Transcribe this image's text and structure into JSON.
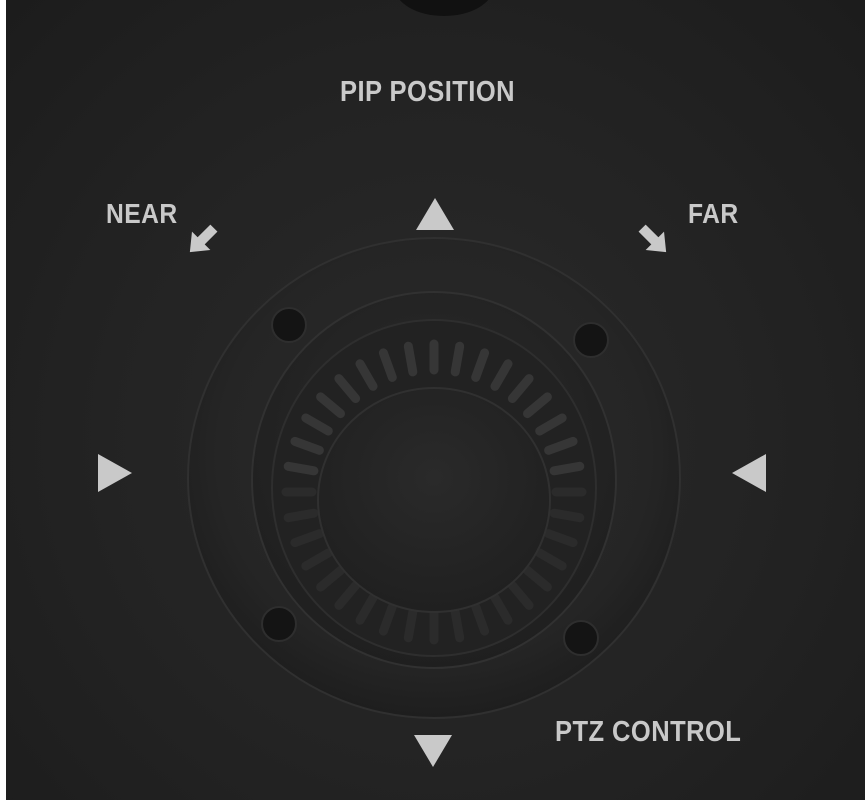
{
  "panel": {
    "title_label": "PIP POSITION",
    "near_label": "NEAR",
    "far_label": "FAR",
    "control_label": "PTZ CONTROL",
    "colors": {
      "background": "#232323",
      "label_text": "#c9c9c9",
      "arrow_fill": "#c9c9c9",
      "joystick_base": "#262626"
    },
    "icons": [
      "up-arrow-icon",
      "down-arrow-icon",
      "left-arrow-icon",
      "right-arrow-icon",
      "near-arrow-icon",
      "far-arrow-icon"
    ]
  }
}
